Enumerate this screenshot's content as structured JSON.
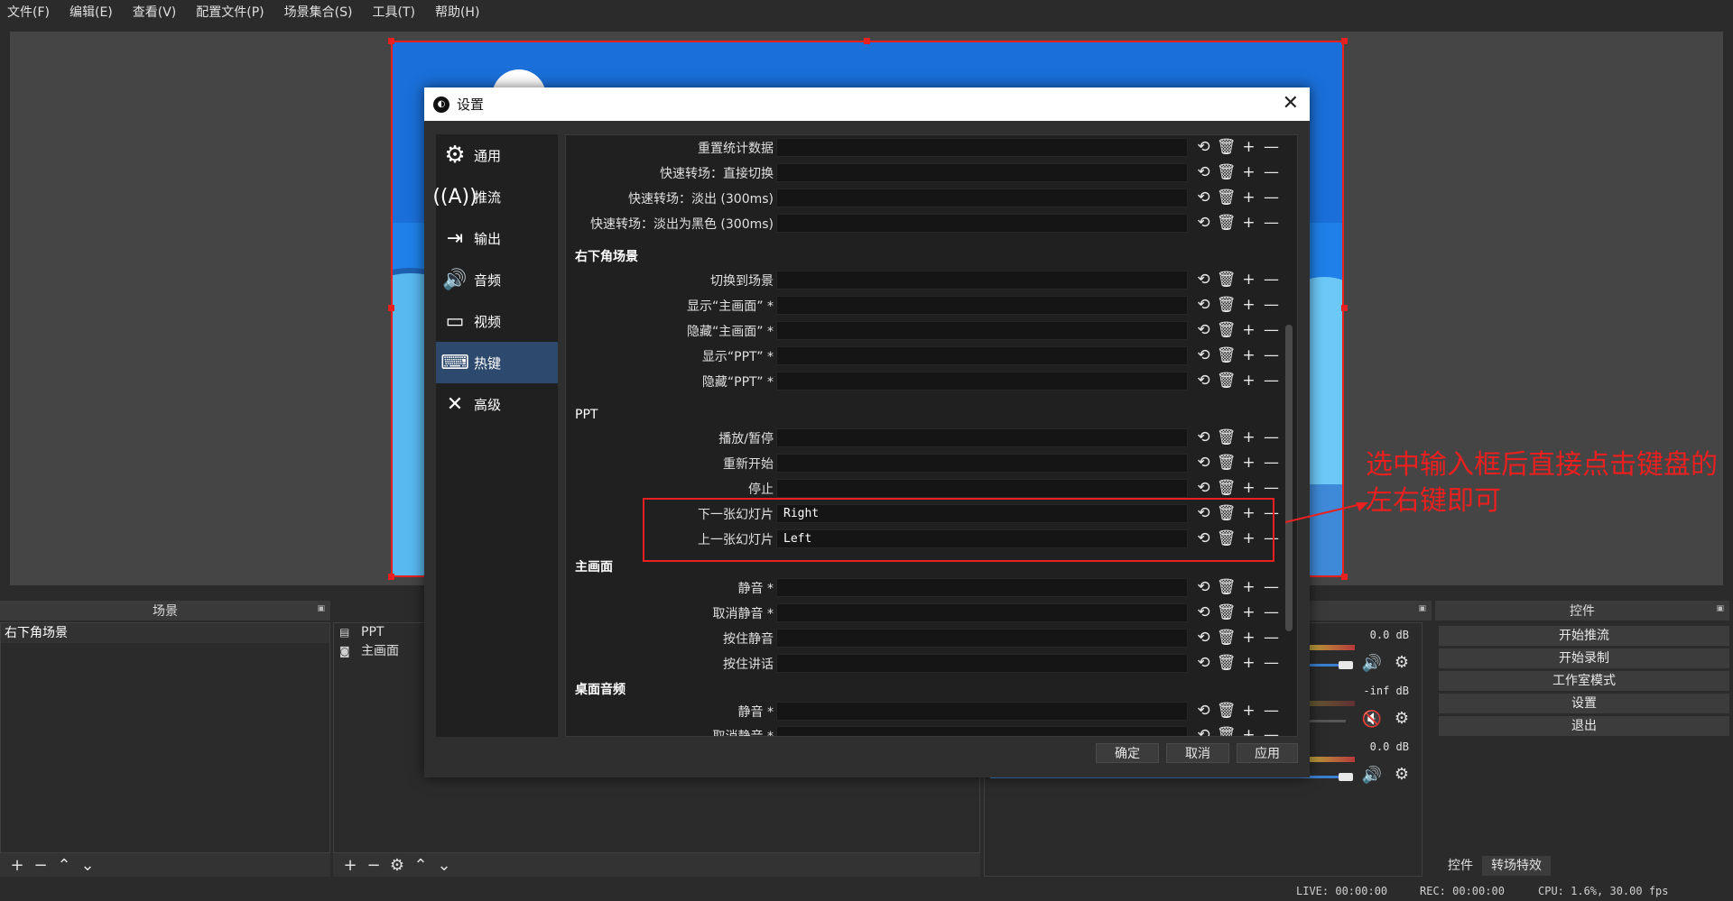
{
  "menubar": {
    "items": [
      "文件(F)",
      "编辑(E)",
      "查看(V)",
      "配置文件(P)",
      "场景集合(S)",
      "工具(T)",
      "帮助(H)"
    ]
  },
  "docks": {
    "scenes": {
      "title": "场景",
      "items": [
        "右下角场景"
      ]
    },
    "sources": {
      "items": [
        {
          "icon": "window-capture-icon",
          "label": "PPT"
        },
        {
          "icon": "camera-icon",
          "label": "主画面"
        }
      ]
    },
    "mixer": {
      "rows": [
        {
          "db": "0.0 dB",
          "muted": false
        },
        {
          "db": "-inf dB",
          "muted": true
        },
        {
          "db": "0.0 dB",
          "muted": false
        }
      ]
    },
    "controls": {
      "title": "控件",
      "buttons": [
        "开始推流",
        "开始录制",
        "工作室模式",
        "设置",
        "退出"
      ],
      "tabs": [
        "控件",
        "转场特效"
      ]
    }
  },
  "statusbar": {
    "live": "LIVE: 00:00:00",
    "rec": "REC: 00:00:00",
    "cpu": "CPU: 1.6%, 30.00 fps"
  },
  "dialog": {
    "title": "设置",
    "categories": [
      {
        "icon": "gear-icon",
        "label": "通用",
        "active": false
      },
      {
        "icon": "antenna-icon",
        "label": "推流",
        "active": false
      },
      {
        "icon": "output-icon",
        "label": "输出",
        "active": false
      },
      {
        "icon": "speaker-icon",
        "label": "音频",
        "active": false
      },
      {
        "icon": "monitor-icon",
        "label": "视频",
        "active": false
      },
      {
        "icon": "keyboard-icon",
        "label": "热键",
        "active": true
      },
      {
        "icon": "tools-icon",
        "label": "高级",
        "active": false
      }
    ],
    "hotkey_rows": [
      {
        "label": "重置统计数据",
        "value": ""
      },
      {
        "label": "快速转场：直接切换",
        "value": ""
      },
      {
        "label": "快速转场：淡出 (300ms)",
        "value": ""
      },
      {
        "label": "快速转场：淡出为黑色 (300ms)",
        "value": ""
      },
      {
        "label": "切换到场景",
        "value": ""
      },
      {
        "label": "显示“主画面” *",
        "value": ""
      },
      {
        "label": "隐藏“主画面” *",
        "value": ""
      },
      {
        "label": "显示“PPT” *",
        "value": ""
      },
      {
        "label": "隐藏“PPT” *",
        "value": ""
      },
      {
        "label": "播放/暂停",
        "value": ""
      },
      {
        "label": "重新开始",
        "value": ""
      },
      {
        "label": "停止",
        "value": ""
      },
      {
        "label": "下一张幻灯片",
        "value": "Right"
      },
      {
        "label": "上一张幻灯片",
        "value": "Left"
      },
      {
        "label": "静音 *",
        "value": ""
      },
      {
        "label": "取消静音 *",
        "value": ""
      },
      {
        "label": "按住静音",
        "value": ""
      },
      {
        "label": "按住讲话",
        "value": ""
      },
      {
        "label": "静音 *",
        "value": ""
      },
      {
        "label": "取消静音 *",
        "value": ""
      }
    ],
    "sections": [
      "右下角场景",
      "PPT",
      "主画面",
      "桌面音频"
    ],
    "row_buttons": {
      "reset": "⟲",
      "delete": "🗑",
      "add": "+",
      "remove": "—"
    },
    "buttons": {
      "ok": "确定",
      "cancel": "取消",
      "apply": "应用"
    }
  },
  "annotation": {
    "text": "选中输入框后直接点击键盘的左右键即可",
    "color": "#e82020"
  },
  "colors": {
    "accent": "#2d4a6e",
    "highlight": "#e82020",
    "canvas_blue": "#1e80e8"
  }
}
